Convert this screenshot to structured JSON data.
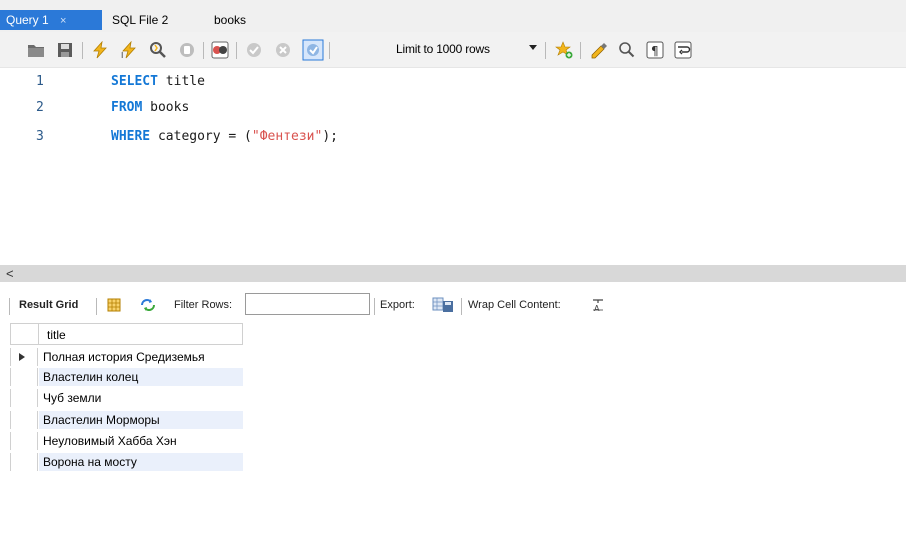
{
  "tabs": [
    {
      "label": "Query 1",
      "active": true,
      "close": "×"
    },
    {
      "label": "SQL File 2",
      "active": false
    },
    {
      "label": "books",
      "active": false
    }
  ],
  "toolbar": {
    "icons": [
      "open-folder-icon",
      "save-icon",
      "execute-icon",
      "execute-current-icon",
      "explain-icon",
      "stop-icon",
      "toggle-error-icon",
      "commit-icon",
      "rollback-icon",
      "autocommit-icon",
      "bookmark-icon",
      "beautify-icon",
      "find-icon",
      "invisible-chars-icon",
      "wrap-lines-icon"
    ],
    "limit_label": "Limit to 1000 rows"
  },
  "editor": {
    "lines": [
      {
        "num": "1",
        "kw": "SELECT",
        "rest": " title"
      },
      {
        "num": "2",
        "kw": "FROM",
        "rest": " books"
      },
      {
        "num": "3",
        "kw": "WHERE",
        "rest": " category = (",
        "str": "\"Фентези\"",
        "tail": ");"
      }
    ]
  },
  "scrollbar": {
    "left_arrow": "<"
  },
  "results": {
    "result_grid_label": "Result Grid",
    "filter_label": "Filter Rows:",
    "filter_value": "",
    "export_label": "Export:",
    "wrap_label": "Wrap Cell Content:",
    "column": "title",
    "rows": [
      "Полная история Средиземья",
      "Властелин колец",
      "Чуб земли",
      "Властелин Морморы",
      "Неуловимый Хабба Хэн",
      "Ворона на мосту"
    ]
  },
  "colors": {
    "accent": "#2b79d8",
    "keyword": "#1478d6",
    "string": "#d9534f",
    "row_alt": "#eaf0fb"
  }
}
